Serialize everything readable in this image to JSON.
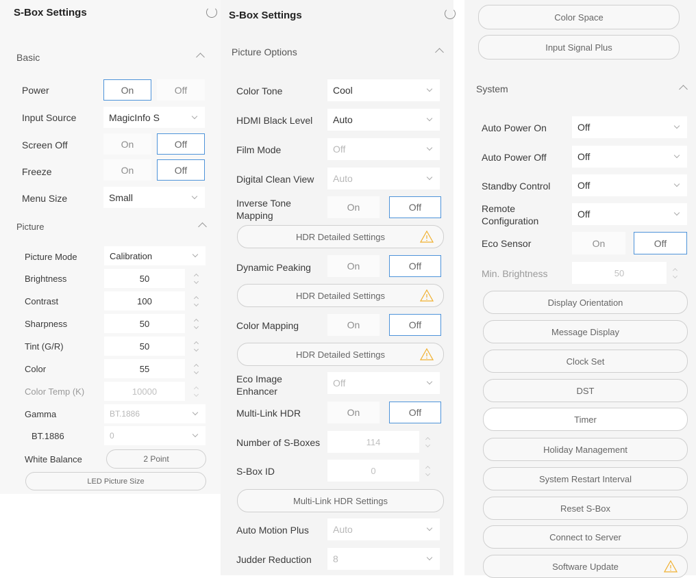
{
  "left": {
    "title": "S-Box Settings",
    "basic": {
      "header": "Basic",
      "power": {
        "label": "Power",
        "on": "On",
        "off": "Off"
      },
      "input_source": {
        "label": "Input Source",
        "value": "MagicInfo S"
      },
      "screen_off": {
        "label": "Screen Off",
        "on": "On",
        "off": "Off"
      },
      "freeze": {
        "label": "Freeze",
        "on": "On",
        "off": "Off"
      },
      "menu_size": {
        "label": "Menu Size",
        "value": "Small"
      }
    },
    "picture": {
      "header": "Picture",
      "mode": {
        "label": "Picture Mode",
        "value": "Calibration"
      },
      "brightness": {
        "label": "Brightness",
        "value": "50"
      },
      "contrast": {
        "label": "Contrast",
        "value": "100"
      },
      "sharpness": {
        "label": "Sharpness",
        "value": "50"
      },
      "tint": {
        "label": "Tint (G/R)",
        "value": "50"
      },
      "color": {
        "label": "Color",
        "value": "55"
      },
      "color_temp": {
        "label": "Color Temp (K)",
        "value": "10000"
      },
      "gamma": {
        "label": "Gamma",
        "value": "BT.1886"
      },
      "bt1886": {
        "label": "BT.1886",
        "value": "0"
      },
      "white_balance": {
        "label": "White Balance",
        "button": "2 Point"
      },
      "led_button": "LED Picture Size"
    }
  },
  "middle": {
    "title": "S-Box Settings",
    "header": "Picture Options",
    "color_tone": {
      "label": "Color Tone",
      "value": "Cool"
    },
    "hdmi_black": {
      "label": "HDMI Black Level",
      "value": "Auto"
    },
    "film_mode": {
      "label": "Film Mode",
      "value": "Off"
    },
    "digital_clean": {
      "label": "Digital Clean View",
      "value": "Auto"
    },
    "inverse_tone": {
      "label": "Inverse Tone Mapping",
      "on": "On",
      "off": "Off"
    },
    "hdr_btn": "HDR Detailed Settings",
    "dynamic_peaking": {
      "label": "Dynamic Peaking",
      "on": "On",
      "off": "Off"
    },
    "color_mapping": {
      "label": "Color Mapping",
      "on": "On",
      "off": "Off"
    },
    "eco_image": {
      "label": "Eco Image Enhancer",
      "value": "Off"
    },
    "multi_link": {
      "label": "Multi-Link HDR",
      "on": "On",
      "off": "Off"
    },
    "num_sboxes": {
      "label": "Number of S-Boxes",
      "value": "114"
    },
    "sbox_id": {
      "label": "S-Box ID",
      "value": "0"
    },
    "multi_link_btn": "Multi-Link HDR Settings",
    "auto_motion": {
      "label": "Auto Motion Plus",
      "value": "Auto"
    },
    "judder": {
      "label": "Judder Reduction",
      "value": "8"
    }
  },
  "right": {
    "color_space_btn": "Color Space",
    "input_signal_btn": "Input Signal Plus",
    "header": "System",
    "auto_power_on": {
      "label": "Auto Power On",
      "value": "Off"
    },
    "auto_power_off": {
      "label": "Auto Power Off",
      "value": "Off"
    },
    "standby": {
      "label": "Standby Control",
      "value": "Off"
    },
    "remote": {
      "label": "Remote Configuration",
      "value": "Off"
    },
    "eco_sensor": {
      "label": "Eco Sensor",
      "on": "On",
      "off": "Off"
    },
    "min_brightness": {
      "label": "Min. Brightness",
      "value": "50"
    },
    "buttons": [
      "Display Orientation",
      "Message Display",
      "Clock Set",
      "DST",
      "Timer",
      "Holiday Management",
      "System Restart Interval",
      "Reset S-Box",
      "Connect to Server",
      "Software Update"
    ]
  },
  "colors": {
    "accent": "#4d93d9",
    "warning": "#f0b030"
  }
}
